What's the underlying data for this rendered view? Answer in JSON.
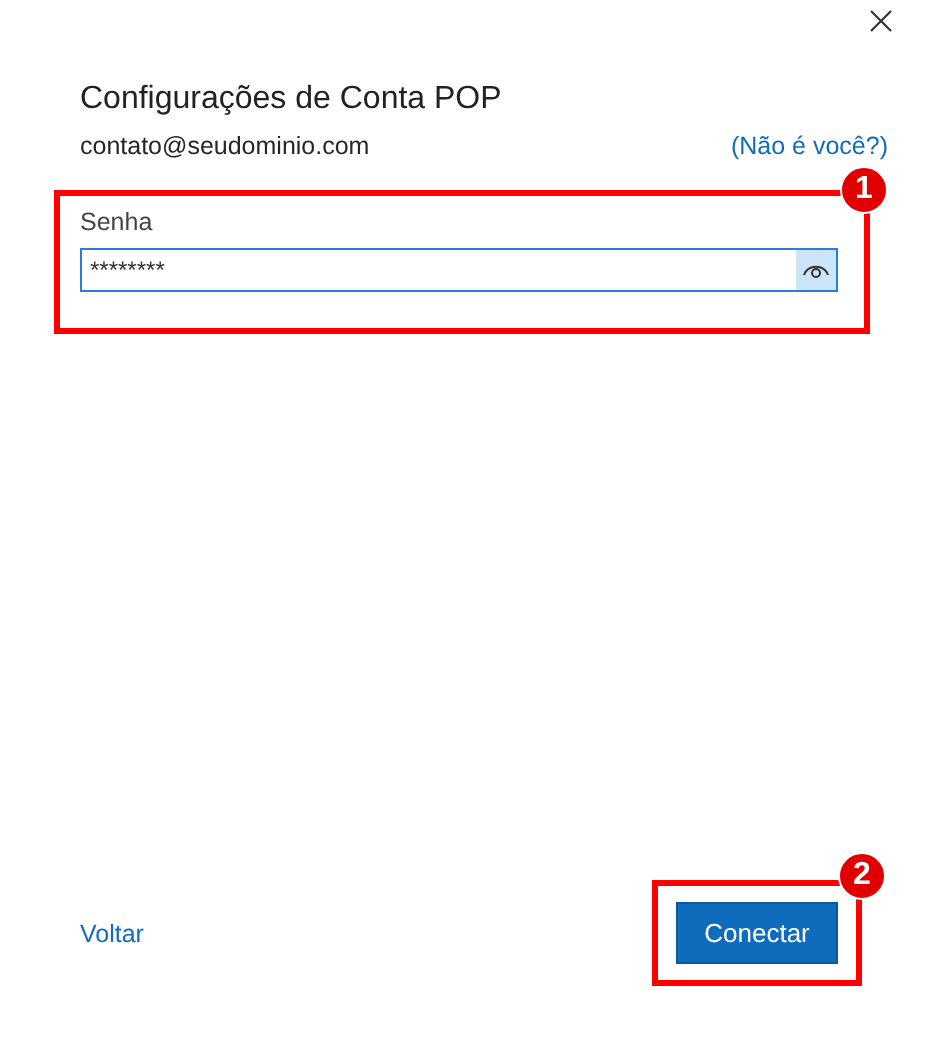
{
  "title": "Configurações de Conta POP",
  "account": {
    "email": "contato@seudominio.com",
    "link": "(Não é você?)"
  },
  "password": {
    "label": "Senha",
    "value": "********"
  },
  "footer": {
    "back": "Voltar",
    "connect": "Conectar"
  },
  "annotations": [
    {
      "number": "1"
    },
    {
      "number": "2"
    }
  ]
}
